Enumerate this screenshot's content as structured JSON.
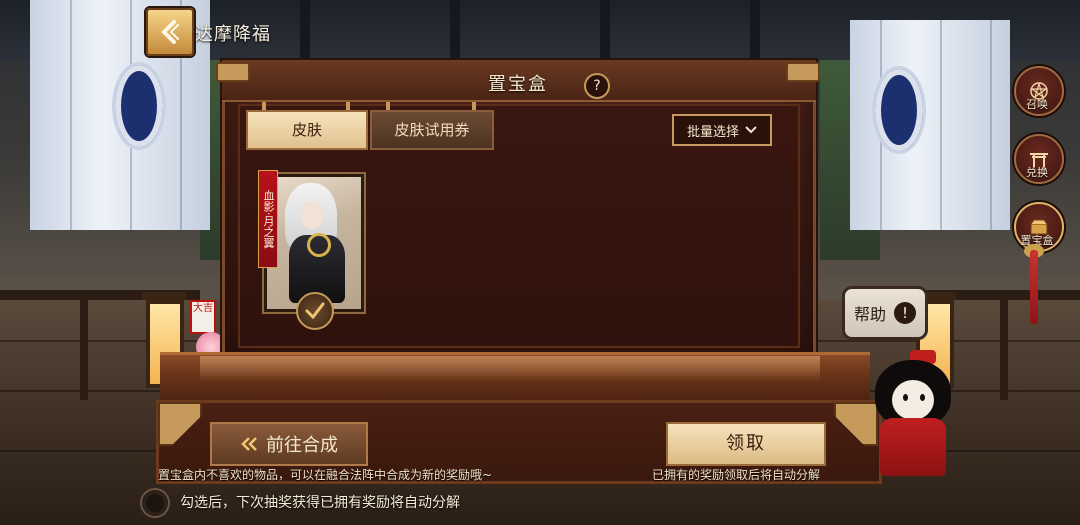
{
  "header": {
    "title": "达摩降福"
  },
  "side_nav": [
    {
      "label": "召唤",
      "icon": "pentagram-icon"
    },
    {
      "label": "兑换",
      "icon": "shrine-gate-icon"
    },
    {
      "label": "置宝盒",
      "icon": "treasure-box-icon"
    }
  ],
  "panel": {
    "title": "置宝盒",
    "help_glyph": "?",
    "tabs": [
      {
        "label": "皮肤",
        "active": true
      },
      {
        "label": "皮肤试用券",
        "active": false
      }
    ],
    "batch_select_label": "批量选择",
    "items": [
      {
        "banner": "血影·月之翼",
        "selected": true
      }
    ]
  },
  "actions": {
    "goto_merge_label": "前往合成",
    "claim_label": "领取",
    "merge_hint": "置宝盒内不喜欢的物品，可以在融合法阵中合成为新的奖励哦~",
    "claim_hint": "已拥有的奖励领取后将自动分解"
  },
  "auto_decompose": {
    "checked": false,
    "label": "勾选后，下次抽奖获得已拥有奖励将自动分解"
  },
  "help_bubble": {
    "label": "帮助",
    "glyph": "!"
  },
  "colors": {
    "panel_bg": "#3e1a13",
    "gold_button": "#f7e3bb",
    "accent_red": "#b8121a",
    "text_light": "#f5e8cc"
  }
}
